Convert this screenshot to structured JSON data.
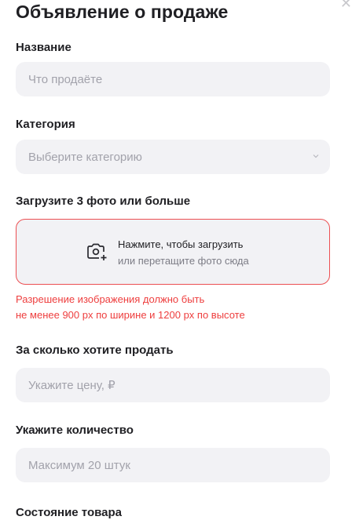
{
  "header": {
    "title": "Объявление о продаже"
  },
  "fields": {
    "name": {
      "label": "Название",
      "placeholder": "Что продаёте"
    },
    "category": {
      "label": "Категория",
      "placeholder": "Выберите категорию"
    },
    "photos": {
      "label": "Загрузите 3 фото или больше",
      "upload_text": "Нажмите, чтобы загрузить",
      "upload_subtext": "или перетащите фото сюда",
      "error_line1": "Разрешение изображения должно быть",
      "error_line2": "не менее 900 px по ширине и 1200 px по высоте"
    },
    "price": {
      "label": "За сколько хотите продать",
      "placeholder": "Укажите цену, ₽"
    },
    "quantity": {
      "label": "Укажите количество",
      "placeholder": "Максимум 20 штук"
    },
    "condition": {
      "label": "Состояние товара"
    }
  },
  "colors": {
    "error": "#ee3e3e",
    "field_bg": "#f2f2f5"
  }
}
